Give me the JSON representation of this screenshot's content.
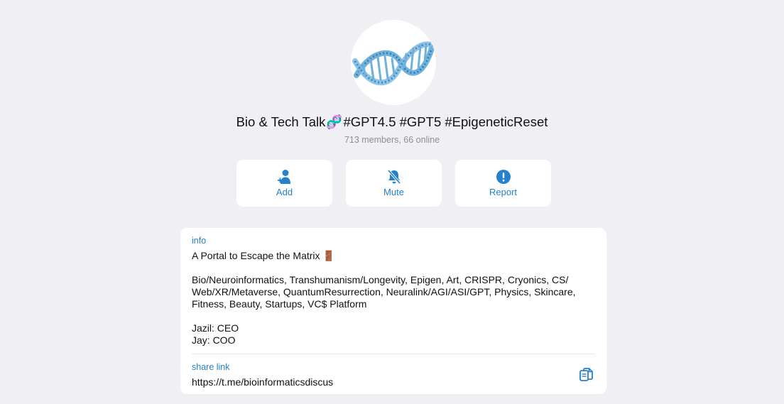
{
  "group": {
    "title_before": "Bio & Tech Talk",
    "title_emoji": "🧬",
    "title_after": "#GPT4.5 #GPT5 #EpigeneticReset",
    "subtitle": "713 members, 66 online",
    "avatar_icon": "dna-helix-icon"
  },
  "actions": [
    {
      "label": "Add",
      "icon": "add-member-icon"
    },
    {
      "label": "Mute",
      "icon": "bell-slash-icon"
    },
    {
      "label": "Report",
      "icon": "exclamation-circle-icon"
    }
  ],
  "info": {
    "label": "info",
    "text": "A Portal to Escape the Matrix 🚪\n\nBio/Neuroinformatics, Transhumanism/Longevity, Epigen, Art, CRISPR, Cryonics, CS/\nWeb/XR/Metaverse, QuantumResurrection, Neuralink/AGI/ASI/GPT, Physics, Skincare,\nFitness, Beauty, Startups, VC$ Platform\n\nJazil: CEO\nJay: COO",
    "share_label": "share link",
    "share_url": "https://t.me/bioinformaticsdiscus",
    "copy_icon": "copy-icon"
  },
  "colors": {
    "accent": "#2481cc",
    "background": "#efeff4",
    "card": "#ffffff",
    "muted": "#8e8e93"
  }
}
